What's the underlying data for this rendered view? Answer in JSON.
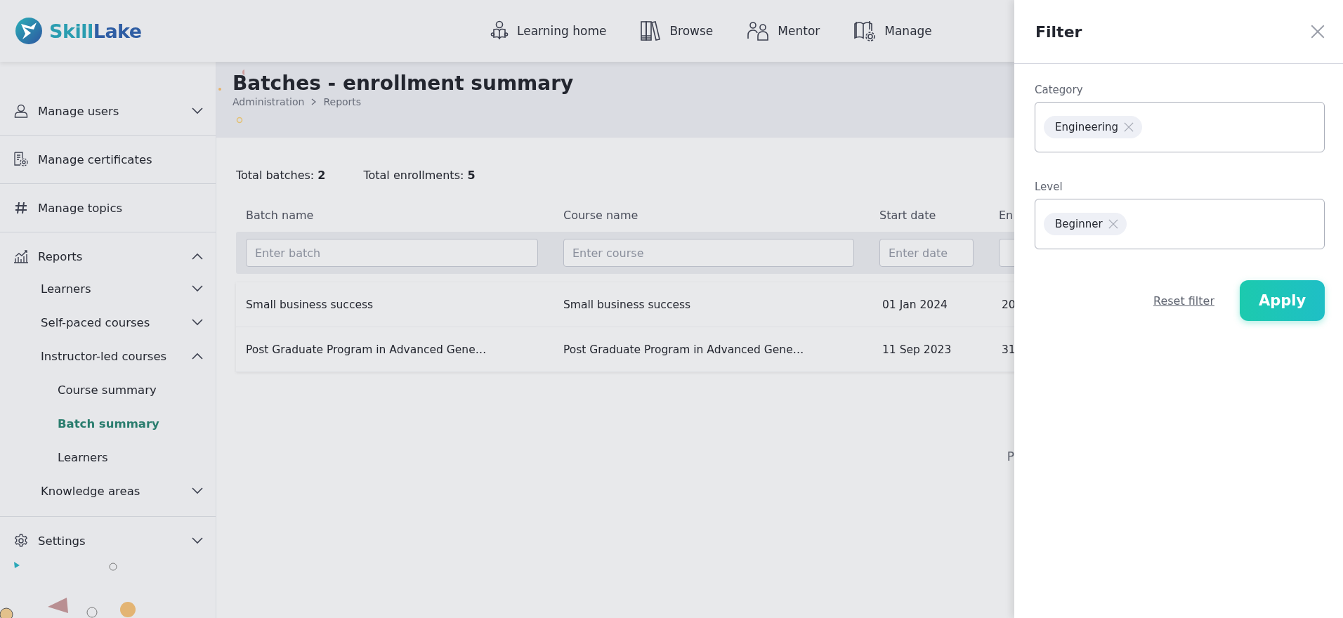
{
  "logo": {
    "parts": [
      "Skill",
      "Lake"
    ]
  },
  "nav": [
    {
      "label": "Learning home"
    },
    {
      "label": "Browse"
    },
    {
      "label": "Mentor"
    },
    {
      "label": "Manage"
    }
  ],
  "sidebar": {
    "items": [
      {
        "label": "Manage users",
        "expanded": false
      },
      {
        "label": "Manage certificates"
      },
      {
        "label": "Manage topics"
      },
      {
        "label": "Reports",
        "expanded": true,
        "children": [
          {
            "label": "Learners",
            "expanded": false
          },
          {
            "label": "Self-paced courses",
            "expanded": false
          },
          {
            "label": "Instructor-led courses",
            "expanded": true,
            "children": [
              {
                "label": "Course summary",
                "selected": false
              },
              {
                "label": "Batch summary",
                "selected": true
              },
              {
                "label": "Learners",
                "selected": false
              }
            ]
          },
          {
            "label": "Knowledge areas",
            "expanded": false
          }
        ]
      },
      {
        "label": "Settings",
        "expanded": false
      }
    ]
  },
  "page": {
    "title": "Batches - enrollment summary",
    "breadcrumb": [
      "Administration",
      "Reports"
    ],
    "totals": [
      {
        "label": "Total batches:",
        "value": "2"
      },
      {
        "label": "Total enrollments:",
        "value": "5"
      }
    ]
  },
  "table": {
    "columns": [
      {
        "header": "Batch name",
        "placeholder": "Enter batch"
      },
      {
        "header": "Course name",
        "placeholder": "Enter course"
      },
      {
        "header": "Start date",
        "placeholder": "Enter date"
      },
      {
        "header": "En"
      }
    ],
    "rows": [
      [
        "Small business success",
        "Small business success",
        "01 Jan 2024",
        "20"
      ],
      [
        "Post Graduate Program in Advanced Gene…",
        "Post Graduate Program in Advanced Gene…",
        "11 Sep 2023",
        "31"
      ]
    ]
  },
  "pagination": {
    "text": "P"
  },
  "filter": {
    "title": "Filter",
    "fields": [
      {
        "label": "Category",
        "chips": [
          "Engineering"
        ]
      },
      {
        "label": "Level",
        "chips": [
          "Beginner"
        ]
      }
    ],
    "reset": "Reset filter",
    "apply": "Apply"
  }
}
